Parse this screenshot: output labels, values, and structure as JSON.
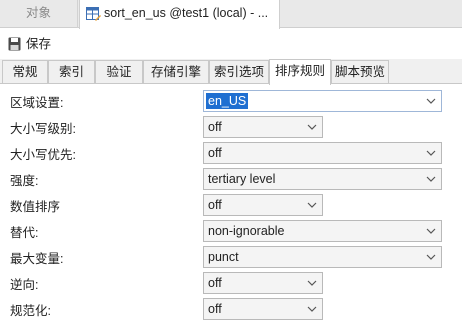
{
  "doc_tabs": {
    "inactive_label": "对象",
    "active_label": "sort_en_us @test1 (local) - ..."
  },
  "toolbar": {
    "save_label": "保存"
  },
  "sub_tabs": [
    {
      "label": "常规"
    },
    {
      "label": "索引"
    },
    {
      "label": "验证"
    },
    {
      "label": "存储引擎"
    },
    {
      "label": "索引选项"
    },
    {
      "label": "排序规则"
    },
    {
      "label": "脚本预览"
    }
  ],
  "active_sub_tab": "排序规则",
  "fields": {
    "locale": {
      "label": "区域设置:",
      "value": "en_US"
    },
    "case_level": {
      "label": "大小写级别:",
      "value": "off"
    },
    "case_first": {
      "label": "大小写优先:",
      "value": "off"
    },
    "strength": {
      "label": "强度:",
      "value": "tertiary level"
    },
    "numeric_ordering": {
      "label": "数值排序",
      "value": "off"
    },
    "alternate": {
      "label": "替代:",
      "value": "non-ignorable"
    },
    "max_variable": {
      "label": "最大变量:",
      "value": "punct"
    },
    "backwards": {
      "label": "逆向:",
      "value": "off"
    },
    "normalization": {
      "label": "规范化:",
      "value": "off"
    }
  },
  "colors": {
    "selection": "#1f6fd1",
    "tab_bg": "#e9e9e9"
  }
}
